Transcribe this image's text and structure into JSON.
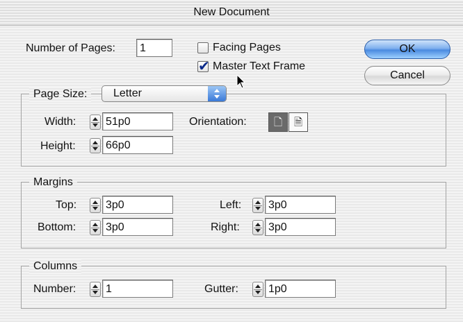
{
  "window": {
    "title": "New Document"
  },
  "document": {
    "pages_label": "Number of Pages:",
    "pages_value": "1",
    "facing_pages_label": "Facing Pages",
    "facing_pages_checked": false,
    "master_text_frame_label": "Master Text Frame",
    "master_text_frame_checked": true
  },
  "buttons": {
    "ok": "OK",
    "cancel": "Cancel"
  },
  "page_size": {
    "label": "Page Size:",
    "selected": "Letter",
    "width_label": "Width:",
    "width_value": "51p0",
    "height_label": "Height:",
    "height_value": "66p0",
    "orientation_label": "Orientation:",
    "orientation_selected": "portrait",
    "portrait_icon": "portrait-page-icon",
    "landscape_icon": "landscape-page-icon"
  },
  "margins": {
    "title": "Margins",
    "top_label": "Top:",
    "top_value": "3p0",
    "bottom_label": "Bottom:",
    "bottom_value": "3p0",
    "left_label": "Left:",
    "left_value": "3p0",
    "right_label": "Right:",
    "right_value": "3p0"
  },
  "columns": {
    "title": "Columns",
    "number_label": "Number:",
    "number_value": "1",
    "gutter_label": "Gutter:",
    "gutter_value": "1p0"
  },
  "colors": {
    "accent": "#4b8be0",
    "checkmark": "#0b2a8a"
  }
}
